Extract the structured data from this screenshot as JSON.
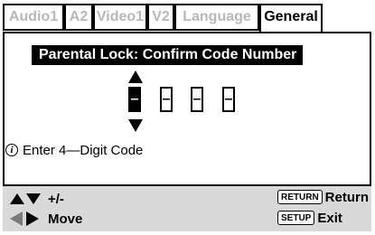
{
  "tabs": [
    {
      "label": "Audio1",
      "active": false
    },
    {
      "label": "A2",
      "active": false
    },
    {
      "label": "Video1",
      "active": false
    },
    {
      "label": "V2",
      "active": false
    },
    {
      "label": "Language",
      "active": false
    },
    {
      "label": "General",
      "active": true
    }
  ],
  "dialog": {
    "title": "Parental Lock: Confirm Code Number",
    "digits": [
      "–",
      "–",
      "–",
      "–"
    ],
    "active_digit": 0
  },
  "info": {
    "icon": "i",
    "text": "Enter 4—Digit Code"
  },
  "footer": {
    "adjust_label": "+/-",
    "move_label": "Move",
    "return_key": "RETURN",
    "return_label": "Return",
    "setup_key": "SETUP",
    "exit_label": "Exit"
  }
}
